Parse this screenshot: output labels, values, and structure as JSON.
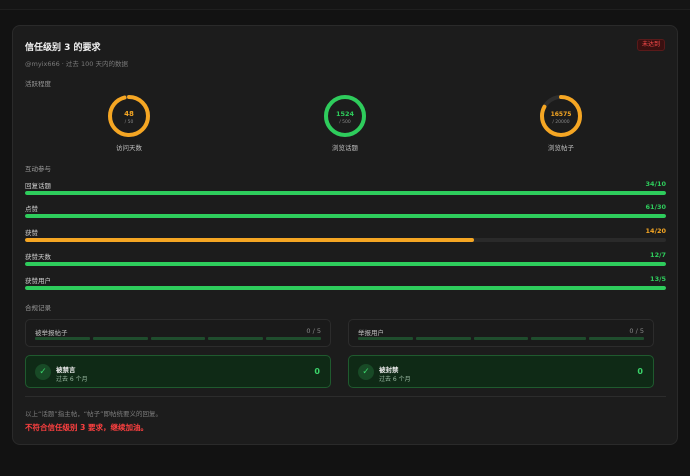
{
  "card": {
    "title": "信任级别 3 的要求",
    "status_badge": "未达到",
    "subtitle": "@myix666 · 过去 100 天内的数据"
  },
  "activity": {
    "label": "活跃程度",
    "gauges": [
      {
        "value": "48",
        "target": "/ 50",
        "fraction": 0.96,
        "color": "#f5a623",
        "caption": "访问天数"
      },
      {
        "value": "1524",
        "target": "/ 500",
        "fraction": 1.0,
        "color": "#2ecc5c",
        "caption": "浏览话题"
      },
      {
        "value": "16575",
        "target": "/ 20000",
        "fraction": 0.83,
        "color": "#f5a623",
        "caption": "浏览帖子"
      }
    ]
  },
  "interaction": {
    "label": "互动参与",
    "rows": [
      {
        "label": "回复话题",
        "value": "34/10",
        "fraction": 1.0,
        "color": "#2ecc5c"
      },
      {
        "label": "点赞",
        "value": "61/30",
        "fraction": 1.0,
        "color": "#2ecc5c"
      },
      {
        "label": "获赞",
        "value": "14/20",
        "fraction": 0.7,
        "color": "#f5a623"
      },
      {
        "label": "获赞天数",
        "value": "12/7",
        "fraction": 1.0,
        "color": "#2ecc5c"
      },
      {
        "label": "获赞用户",
        "value": "13/5",
        "fraction": 1.0,
        "color": "#2ecc5c"
      }
    ]
  },
  "compliance": {
    "label": "合规记录",
    "violations": [
      {
        "label": "被举报帖子",
        "count": "0 / 5"
      },
      {
        "label": "举报用户",
        "count": "0 / 5"
      }
    ],
    "status": [
      {
        "title": "被禁言",
        "period": "过去 6 个月",
        "value": "0"
      },
      {
        "title": "被封禁",
        "period": "过去 6 个月",
        "value": "0"
      }
    ]
  },
  "footer": {
    "note": "以上“话题”指主帖，“帖子”即帖统要义的回复。",
    "result": "不符合信任级别 3 要求，继续加油。"
  },
  "colors": {
    "ok": "#2ecc5c",
    "warn": "#f5a623",
    "fail": "#ff4040"
  }
}
